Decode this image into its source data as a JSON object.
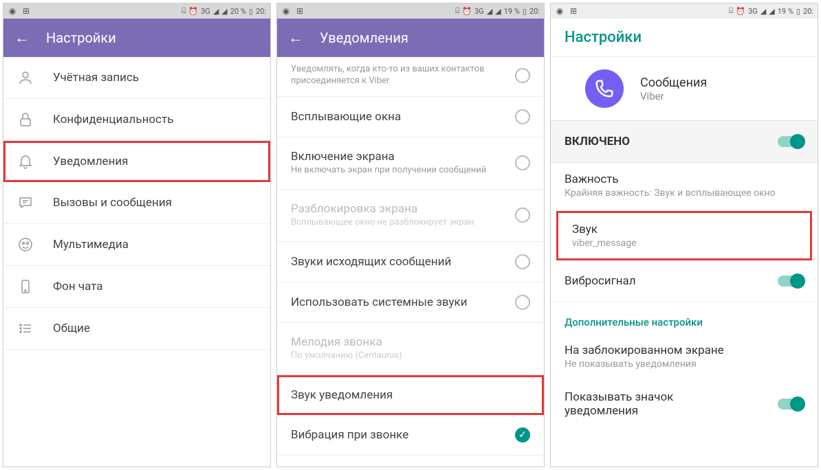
{
  "status": {
    "battery1": "20 %",
    "battery2": "19 %",
    "battery3": "19 %",
    "time": "20:",
    "net": "3G"
  },
  "phone1": {
    "header": "Настройки",
    "items": [
      {
        "label": "Учётная запись",
        "icon": "user"
      },
      {
        "label": "Конфиденциальность",
        "icon": "lock"
      },
      {
        "label": "Уведомления",
        "icon": "bell",
        "highlight": true
      },
      {
        "label": "Вызовы и сообщения",
        "icon": "chat"
      },
      {
        "label": "Мультимедиа",
        "icon": "media"
      },
      {
        "label": "Фон чата",
        "icon": "phone"
      },
      {
        "label": "Общие",
        "icon": "list"
      }
    ]
  },
  "phone2": {
    "header": "Уведомления",
    "partial_sub": "Уведомлять, когда кто-то из ваших контактов присоединяется к Viber",
    "items": [
      {
        "title": "Всплывающие окна"
      },
      {
        "title": "Включение экрана",
        "sub": "Не включать экран при получении сообщений"
      },
      {
        "title": "Разблокировка экрана",
        "sub": "Всплывающее окно не разблокирует экран",
        "disabled": true
      },
      {
        "title": "Звуки исходящих сообщений"
      },
      {
        "title": "Использовать системные звуки"
      },
      {
        "title": "Мелодия звонка",
        "sub": "По умолчанию (Centaurus)",
        "noradio": true,
        "disabled": true
      },
      {
        "title": "Звук уведомления",
        "noradio": true,
        "highlight": true
      },
      {
        "title": "Вибрация при звонке",
        "checked": true
      }
    ]
  },
  "phone3": {
    "header": "Настройки",
    "app_name": "Сообщения",
    "app_sub": "Viber",
    "enabled": "ВКЛЮЧЕНО",
    "importance_title": "Важность",
    "importance_sub": "Крайняя важность: Звук и всплывающее окно",
    "sound_title": "Звук",
    "sound_sub": "viber_message",
    "vibro": "Вибросигнал",
    "section": "Дополнительные настройки",
    "lock_title": "На заблокированном экране",
    "lock_sub": "Не показывать уведомления",
    "badge": "Показывать значок уведомления"
  }
}
